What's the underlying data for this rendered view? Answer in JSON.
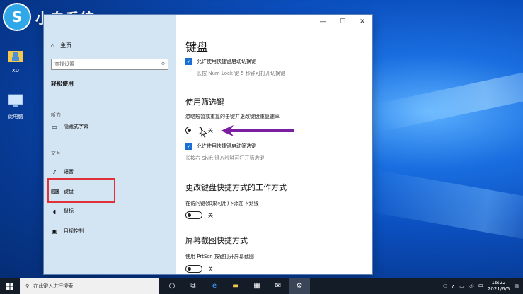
{
  "desktop": {
    "logo_badge": "S",
    "logo_text": "小白系统",
    "icons": [
      {
        "label": "XU"
      },
      {
        "label": "此电脑"
      }
    ]
  },
  "window": {
    "controls": {
      "minimize": "—",
      "maximize": "☐",
      "close": "✕"
    },
    "sidebar": {
      "home_label": "主页",
      "search_placeholder": "查找设置",
      "heading": "轻松使用",
      "section_hearing": "听力",
      "item_captions": "隐藏式字幕",
      "section_interaction": "交互",
      "item_speech": "语音",
      "item_keyboard": "键盘",
      "item_mouse": "鼠标",
      "item_eye_control": "目视控制"
    },
    "content": {
      "title": "键盘",
      "toggle_keys_shortcut": "允许使用快捷键启动切换键",
      "toggle_keys_hint": "长按 Num Lock 键 5 秒钟可打开切换键",
      "filter_keys_title": "使用筛选键",
      "filter_keys_desc": "忽略短暂或重复的击键并更改键盘重复速率",
      "filter_keys_state": "关",
      "filter_keys_shortcut": "允许使用快捷键启动筛选键",
      "filter_keys_hint": "长按右 Shift 键八秒钟可打开筛选键",
      "shortcut_title": "更改键盘快捷方式的工作方式",
      "underline_desc": "在访问键(如果可用)下添加下划线",
      "underline_state": "关",
      "printscreen_title": "屏幕截图快捷方式",
      "printscreen_desc": "使用 PrtScn 按键打开屏幕截图",
      "printscreen_state": "关"
    }
  },
  "taskbar": {
    "search_placeholder": "在此键入进行搜索",
    "lang": "中",
    "time": "16:22",
    "date": "2021/6/5"
  },
  "colors": {
    "accent": "#1a6fd2",
    "sidebar_bg": "#d3e4f3",
    "highlight": "#e0313a",
    "arrow": "#7b1fa2",
    "taskbar_bg": "#141c28"
  }
}
